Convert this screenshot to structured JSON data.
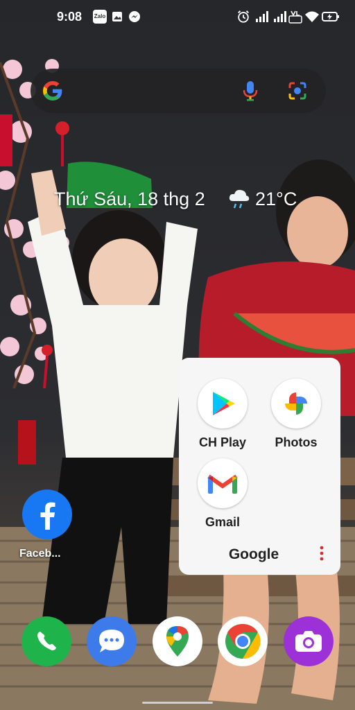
{
  "status_bar": {
    "time": "9:08",
    "zalo_label": "Zalo",
    "icons": [
      "zalo-icon",
      "image-icon",
      "messenger-icon",
      "alarm-icon",
      "signal-icon",
      "signal-icon",
      "volte-icon",
      "wifi-icon",
      "battery-charging-icon"
    ]
  },
  "search": {
    "icons": [
      "google-g-icon",
      "mic-icon",
      "lens-icon"
    ]
  },
  "glance": {
    "date": "Thứ Sáu, 18 thg 2",
    "weather_icon": "rain-cloud-icon",
    "temperature": "21°C"
  },
  "home_apps": [
    {
      "label": "Faceb...",
      "icon": "facebook-icon"
    }
  ],
  "folder": {
    "title": "Google",
    "apps": [
      {
        "label": "CH Play",
        "icon": "play-store-icon"
      },
      {
        "label": "Photos",
        "icon": "google-photos-icon"
      },
      {
        "label": "Gmail",
        "icon": "gmail-icon"
      }
    ],
    "menu_icon": "more-vert-icon",
    "menu_color": "#d32f2f"
  },
  "dock": [
    "phone-icon",
    "messages-icon",
    "maps-icon",
    "chrome-icon",
    "camera-icon"
  ]
}
